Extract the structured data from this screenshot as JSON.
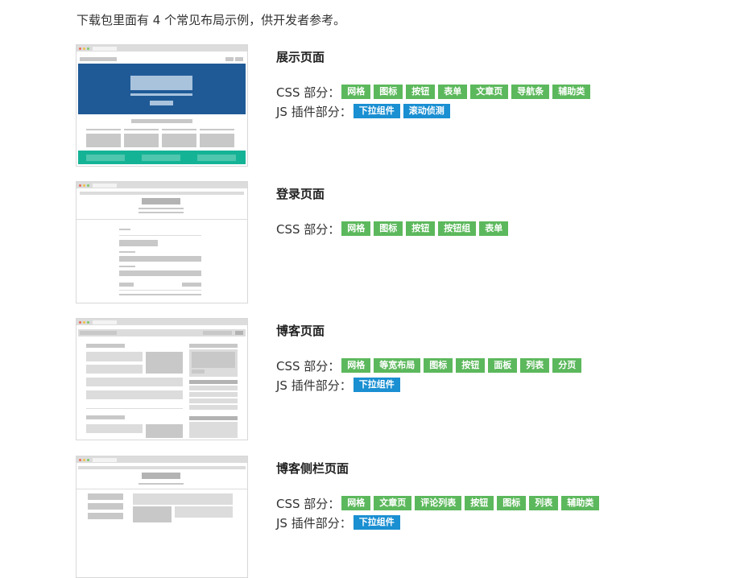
{
  "intro": "下载包里面有 4 个常见布局示例，供开发者参考。",
  "items": [
    {
      "title": "展示页面",
      "css_label": "CSS 部分：",
      "css_tags": [
        "网格",
        "图标",
        "按钮",
        "表单",
        "文章页",
        "导航条",
        "辅助类"
      ],
      "js_label": "JS 插件部分：",
      "js_tags": [
        "下拉组件",
        "滚动侦测"
      ]
    },
    {
      "title": "登录页面",
      "css_label": "CSS 部分：",
      "css_tags": [
        "网格",
        "图标",
        "按钮",
        "按钮组",
        "表单"
      ]
    },
    {
      "title": "博客页面",
      "css_label": "CSS 部分：",
      "css_tags": [
        "网格",
        "等宽布局",
        "图标",
        "按钮",
        "面板",
        "列表",
        "分页"
      ],
      "js_label": "JS 插件部分：",
      "js_tags": [
        "下拉组件"
      ]
    },
    {
      "title": "博客侧栏页面",
      "css_label": "CSS 部分：",
      "css_tags": [
        "网格",
        "文章页",
        "评论列表",
        "按钮",
        "图标",
        "列表",
        "辅助类"
      ],
      "js_label": "JS 插件部分：",
      "js_tags": [
        "下拉组件"
      ]
    }
  ],
  "colors": {
    "css_tag": "#5cb85c",
    "js_tag": "#1a8fd2",
    "hero_blue": "#1f5a96",
    "footer_teal": "#15b396"
  }
}
